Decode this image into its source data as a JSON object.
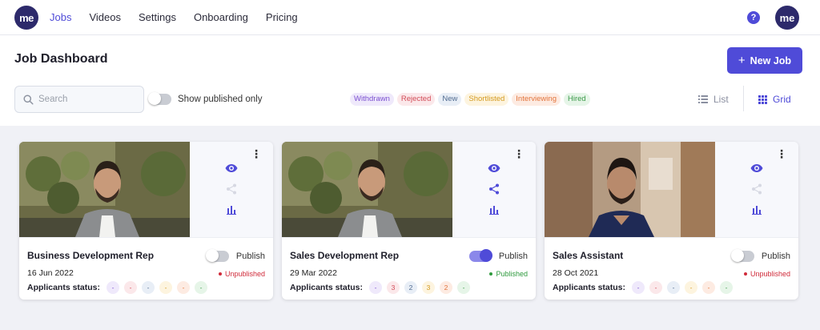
{
  "nav": {
    "logo_text": "me",
    "links": [
      "Jobs",
      "Videos",
      "Settings",
      "Onboarding",
      "Pricing"
    ],
    "active": "Jobs",
    "help_label": "?",
    "avatar_text": "me"
  },
  "header": {
    "title": "Job Dashboard",
    "new_job_label": "New Job",
    "search_placeholder": "Search",
    "show_published_label": "Show published only"
  },
  "chips": [
    {
      "label": "Withdrawn",
      "color": "#7a4fd0",
      "bg": "#efe9fb"
    },
    {
      "label": "Rejected",
      "color": "#d24b57",
      "bg": "#fbe8ea"
    },
    {
      "label": "New",
      "color": "#4f6a8f",
      "bg": "#e8eef6"
    },
    {
      "label": "Shortlisted",
      "color": "#d49a1f",
      "bg": "#fdf4df"
    },
    {
      "label": "Interviewing",
      "color": "#e2733a",
      "bg": "#fdebe2"
    },
    {
      "label": "Hired",
      "color": "#3c9a4a",
      "bg": "#e6f5e8"
    }
  ],
  "view": {
    "list_label": "List",
    "grid_label": "Grid",
    "active": "Grid"
  },
  "jobs": [
    {
      "title": "Business Development Rep",
      "date": "16 Jun 2022",
      "published": false,
      "publish_label": "Publish",
      "status": "Unpublished",
      "status_color": "#d02b3a",
      "applicants_label": "Applicants status:",
      "counts": [
        "-",
        "-",
        "-",
        "-",
        "-",
        "-"
      ],
      "share_enabled": false
    },
    {
      "title": "Sales Development Rep",
      "date": "29 Mar 2022",
      "published": true,
      "publish_label": "Publish",
      "status": "Published",
      "status_color": "#2e9a3d",
      "applicants_label": "Applicants status:",
      "counts": [
        "-",
        "3",
        "2",
        "3",
        "2",
        "-"
      ],
      "share_enabled": true
    },
    {
      "title": "Sales Assistant",
      "date": "28 Oct 2021",
      "published": false,
      "publish_label": "Publish",
      "status": "Unpublished",
      "status_color": "#d02b3a",
      "applicants_label": "Applicants status:",
      "counts": [
        "-",
        "-",
        "-",
        "-",
        "-",
        "-"
      ],
      "share_enabled": false
    }
  ],
  "colors": {
    "accent": "#4f4bd8",
    "brand_dark": "#2d2a6b",
    "page_bg": "#f0f1f6"
  }
}
